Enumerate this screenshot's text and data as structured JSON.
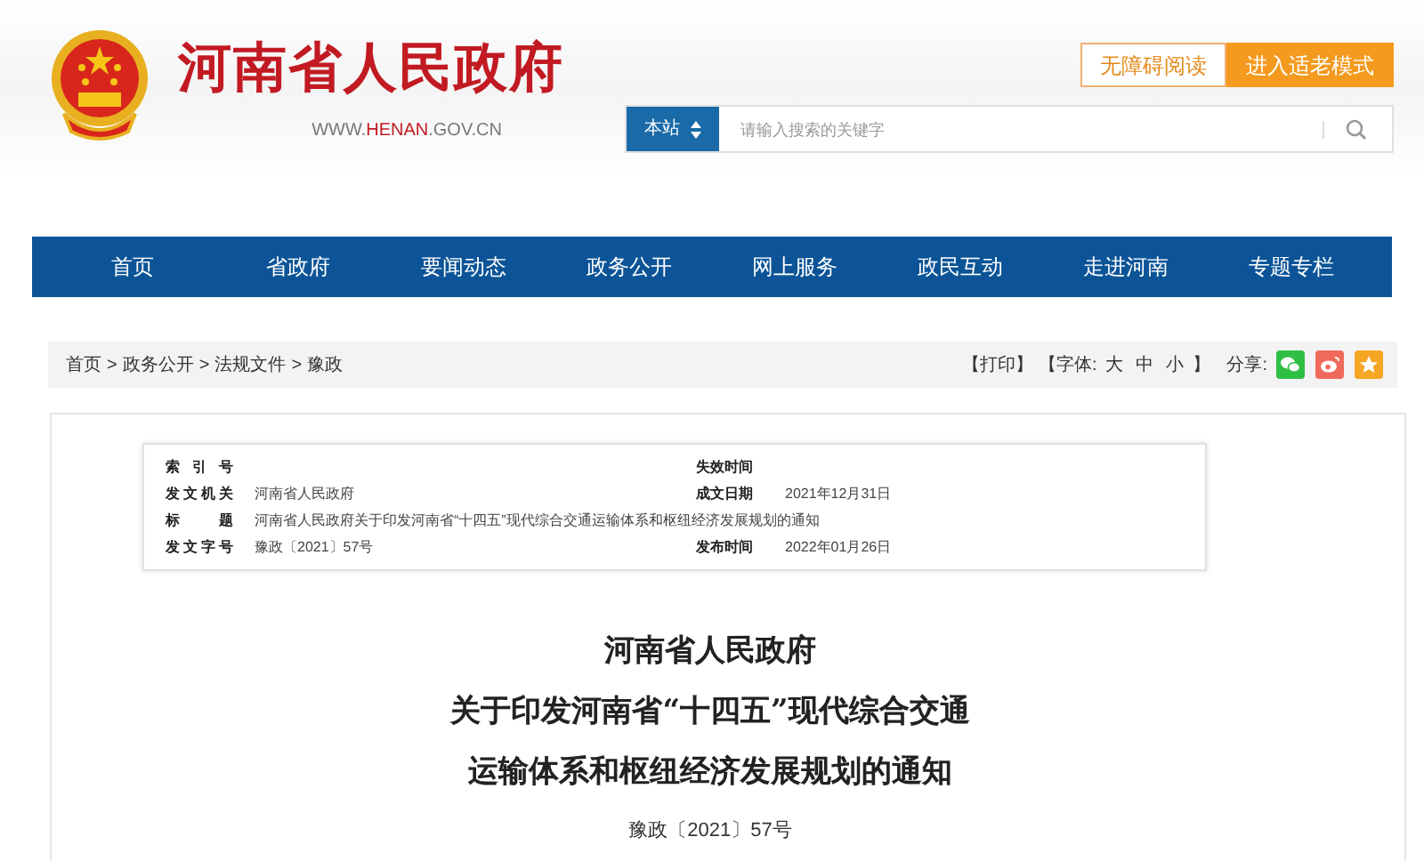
{
  "header": {
    "site_title": "河南省人民政府",
    "site_url_parts": [
      "WWW.",
      "HENAN",
      ".GOV.CN"
    ],
    "accessibility_buttons": [
      {
        "label": "无障碍阅读",
        "kind": "outline"
      },
      {
        "label": "进入适老模式",
        "kind": "filled"
      }
    ],
    "search": {
      "scope": "本站",
      "placeholder": "请输入搜索的关键字"
    }
  },
  "nav": {
    "items": [
      "首页",
      "省政府",
      "要闻动态",
      "政务公开",
      "网上服务",
      "政民互动",
      "走进河南",
      "专题专栏"
    ]
  },
  "breadcrumb": {
    "separator": ">",
    "items": [
      "首页",
      "政务公开",
      "法规文件",
      "豫政"
    ]
  },
  "tools": {
    "print": "【打印】",
    "font_label": "【字体:",
    "font_sizes": [
      "大",
      "中",
      "小"
    ],
    "font_end": "】",
    "share_label": "分享:"
  },
  "metadata": [
    {
      "label": "索引号",
      "right_label": "失效时间"
    },
    {
      "label": "发文机关",
      "value": "河南省人民政府",
      "right_label": "成文日期",
      "right_value": "2021年12月31日"
    },
    {
      "label": "标题",
      "value": "河南省人民政府关于印发河南省“十四五”现代综合交通运输体系和枢纽经济发展规划的通知"
    },
    {
      "label": "发文字号",
      "value": "豫政〔2021〕57号",
      "right_label": "发布时间",
      "right_value": "2022年01月26日"
    }
  ],
  "document": {
    "title_lines": [
      "河南省人民政府",
      "关于印发河南省“十四五”现代综合交通",
      "运输体系和枢纽经济发展规划的通知"
    ],
    "doc_number": "豫政〔2021〕57号"
  }
}
